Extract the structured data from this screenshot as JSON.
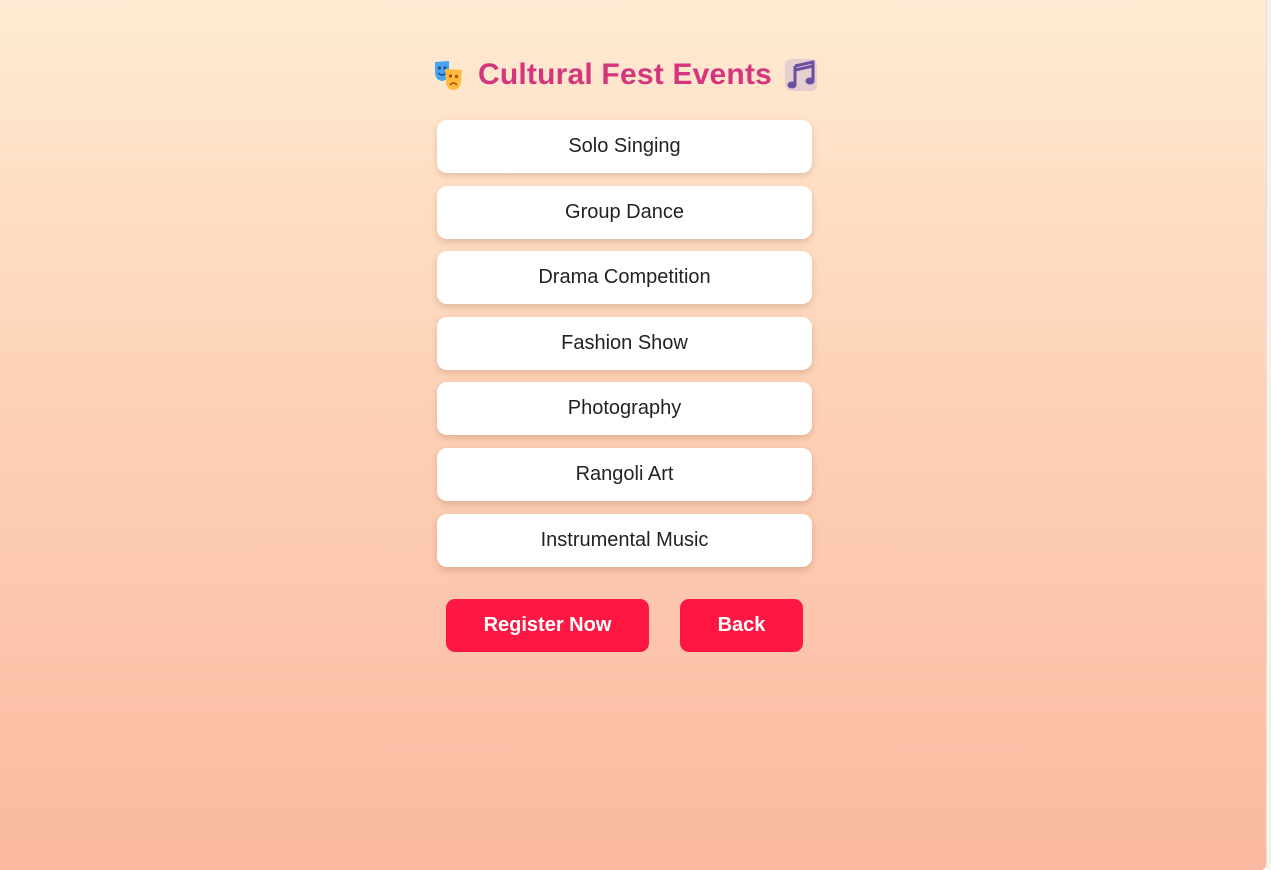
{
  "header": {
    "title": "Cultural Fest Events",
    "left_icon": "theater-masks-icon",
    "right_icon": "music-notes-icon"
  },
  "events": [
    {
      "label": "Solo Singing"
    },
    {
      "label": "Group Dance"
    },
    {
      "label": "Drama Competition"
    },
    {
      "label": "Fashion Show"
    },
    {
      "label": "Photography"
    },
    {
      "label": "Rangoli Art"
    },
    {
      "label": "Instrumental Music"
    }
  ],
  "actions": {
    "register_label": "Register Now",
    "back_label": "Back"
  },
  "colors": {
    "title": "#d4357d",
    "button": "#ff1744",
    "background_top": "#ffebd3",
    "background_bottom": "#fbb8a0"
  }
}
